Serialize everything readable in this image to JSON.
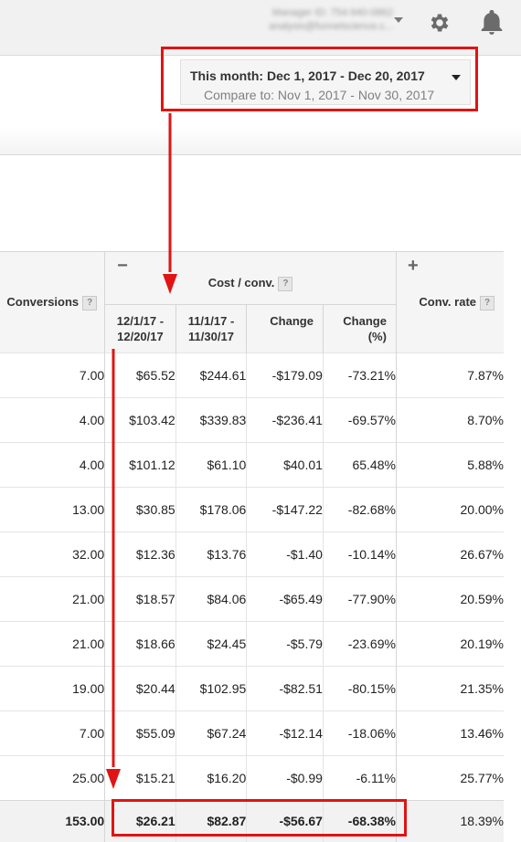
{
  "account": {
    "manager_label": "Manager ID: 754-940-0862",
    "email": "analysis@funnelscience.c..."
  },
  "icons": {
    "settings": "gear-icon",
    "notifications": "bell-icon",
    "account_menu": "caret-down-icon"
  },
  "date_range": {
    "main": "This month: Dec 1, 2017 - Dec 20, 2017",
    "compare": "Compare to: Nov 1, 2017 - Nov 30, 2017"
  },
  "table": {
    "headers": {
      "conversions": "Conversions",
      "cost_group": "Cost / conv.",
      "cost_collapse_symbol": "−",
      "conv_rate": "Conv. rate",
      "conv_rate_expand_symbol": "+",
      "help": "?",
      "period_current_1": "12/1/17 -",
      "period_current_2": "12/20/17",
      "period_prev_1": "11/1/17 -",
      "period_prev_2": "11/30/17",
      "change": "Change",
      "change_pct_1": "Change",
      "change_pct_2": "(%)"
    },
    "rows": [
      {
        "conversions": "7.00",
        "cost_current": "$65.52",
        "cost_prev": "$244.61",
        "change": "-$179.09",
        "change_pct": "-73.21%",
        "conv_rate": "7.87%"
      },
      {
        "conversions": "4.00",
        "cost_current": "$103.42",
        "cost_prev": "$339.83",
        "change": "-$236.41",
        "change_pct": "-69.57%",
        "conv_rate": "8.70%"
      },
      {
        "conversions": "4.00",
        "cost_current": "$101.12",
        "cost_prev": "$61.10",
        "change": "$40.01",
        "change_pct": "65.48%",
        "conv_rate": "5.88%"
      },
      {
        "conversions": "13.00",
        "cost_current": "$30.85",
        "cost_prev": "$178.06",
        "change": "-$147.22",
        "change_pct": "-82.68%",
        "conv_rate": "20.00%"
      },
      {
        "conversions": "32.00",
        "cost_current": "$12.36",
        "cost_prev": "$13.76",
        "change": "-$1.40",
        "change_pct": "-10.14%",
        "conv_rate": "26.67%"
      },
      {
        "conversions": "21.00",
        "cost_current": "$18.57",
        "cost_prev": "$84.06",
        "change": "-$65.49",
        "change_pct": "-77.90%",
        "conv_rate": "20.59%"
      },
      {
        "conversions": "21.00",
        "cost_current": "$18.66",
        "cost_prev": "$24.45",
        "change": "-$5.79",
        "change_pct": "-23.69%",
        "conv_rate": "20.19%"
      },
      {
        "conversions": "19.00",
        "cost_current": "$20.44",
        "cost_prev": "$102.95",
        "change": "-$82.51",
        "change_pct": "-80.15%",
        "conv_rate": "21.35%"
      },
      {
        "conversions": "7.00",
        "cost_current": "$55.09",
        "cost_prev": "$67.24",
        "change": "-$12.14",
        "change_pct": "-18.06%",
        "conv_rate": "13.46%"
      },
      {
        "conversions": "25.00",
        "cost_current": "$15.21",
        "cost_prev": "$16.20",
        "change": "-$0.99",
        "change_pct": "-6.11%",
        "conv_rate": "25.77%"
      }
    ],
    "total": {
      "conversions": "153.00",
      "cost_current": "$26.21",
      "cost_prev": "$82.87",
      "change": "-$56.67",
      "change_pct": "-68.38%",
      "conv_rate": "18.39%"
    }
  },
  "annotation_color": "#e01414"
}
